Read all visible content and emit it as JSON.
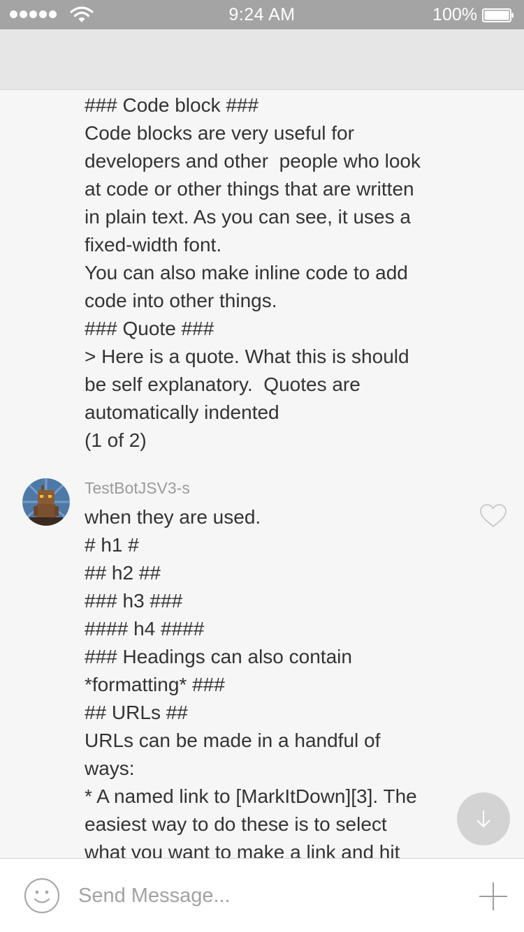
{
  "status_bar": {
    "time": "9:24 AM",
    "battery": "100%"
  },
  "messages": [
    {
      "lines": [
        "### Code block ###",
        "Code blocks are very useful for",
        "developers and other  people who look",
        "at code or other things that are written",
        "in plain text. As you can see, it uses a",
        "fixed-width font.",
        "You can also make inline code to add",
        "code into other things.",
        "### Quote ###",
        "> Here is a quote. What this is should",
        "be self explanatory.  Quotes are",
        "automatically indented",
        "(1 of 2)"
      ]
    },
    {
      "author": "TestBotJSV3-s",
      "lines": [
        "when they are used.",
        "# h1 #",
        "## h2 ##",
        "### h3 ###",
        "#### h4 ####",
        "### Headings can also contain",
        "*formatting* ###",
        "## URLs ##",
        "URLs can be made in a handful of",
        "ways:",
        "* A named link to [MarkItDown][3]. The",
        "easiest way to do these is to select",
        "what you want to make a link and hit"
      ]
    }
  ],
  "composer": {
    "placeholder": "Send Message..."
  },
  "icons": {
    "emoji": "smiley-face-icon",
    "add": "plus-icon",
    "like": "heart-icon",
    "scroll": "arrow-down-icon"
  },
  "colors": {
    "status_bar": "#a4a4a4",
    "nav_bar": "#e6e6e6",
    "background": "#f6f6f6",
    "text": "#333333",
    "muted": "#9b9b9b"
  }
}
